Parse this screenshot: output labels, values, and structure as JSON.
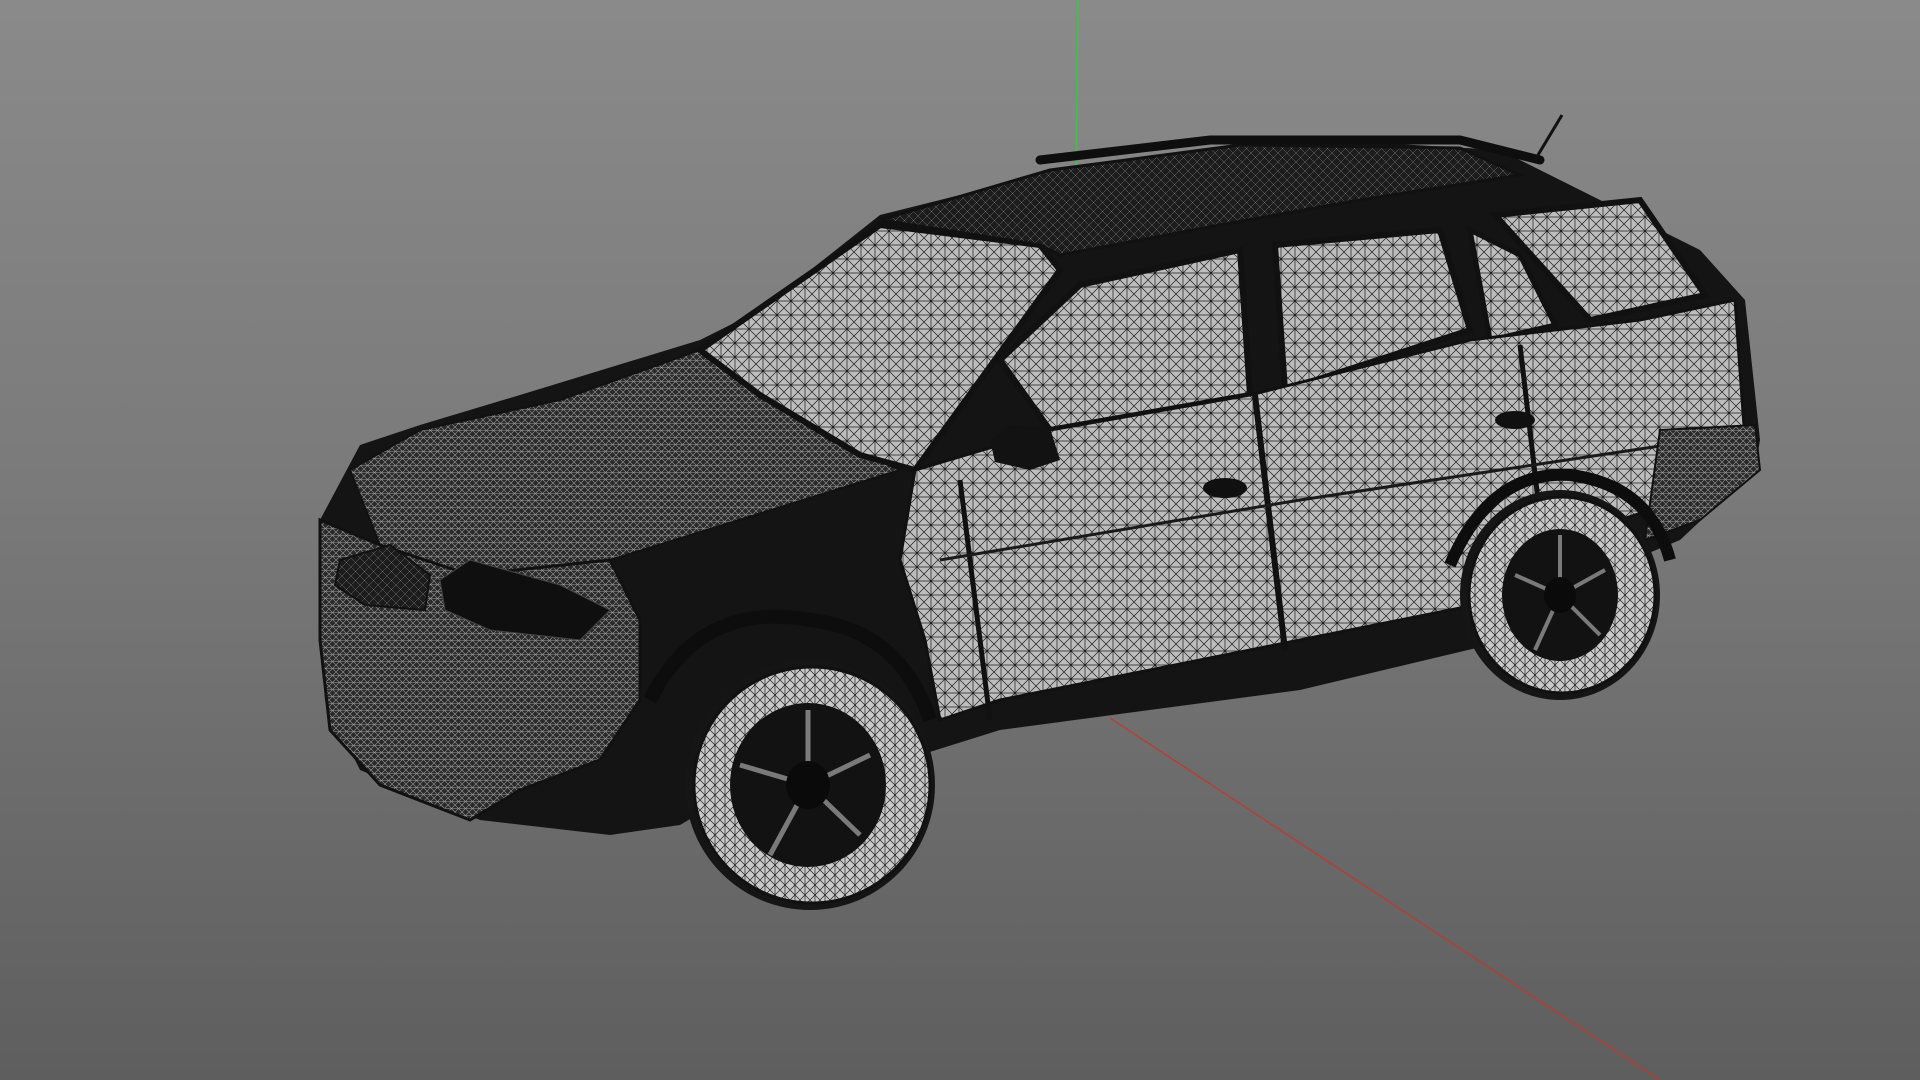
{
  "viewport": {
    "background_top": "#8a8a8a",
    "background_bottom": "#5e5e5e",
    "render_mode": "wireframe"
  },
  "model": {
    "kind": "suv-car-mesh",
    "wire_color": "#1a1a1a",
    "fill_color": "#cfcfcf",
    "dark_color": "#141414"
  },
  "axes": {
    "x_color": "#c0392b",
    "y_color": "#2ecc40"
  }
}
